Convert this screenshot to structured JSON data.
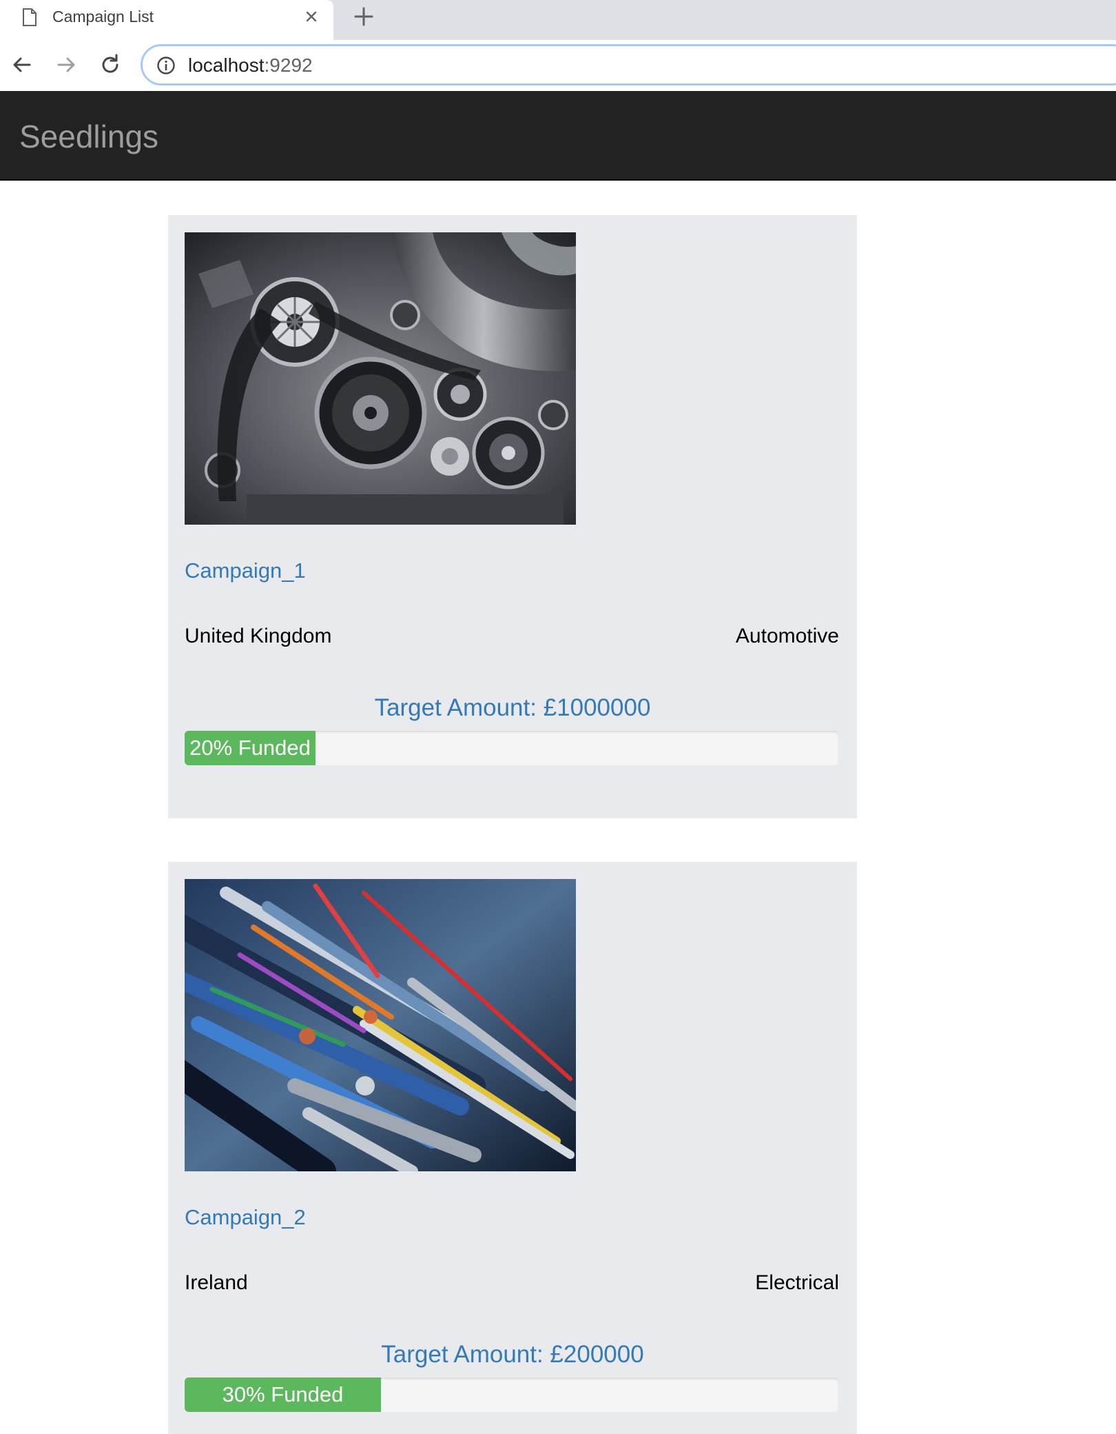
{
  "browser": {
    "tab_title": "Campaign List",
    "url_host": "localhost",
    "url_port": ":9292"
  },
  "navbar": {
    "brand": "Seedlings"
  },
  "campaigns": [
    {
      "name": "Campaign_1",
      "country": "United Kingdom",
      "category": "Automotive",
      "target": "Target Amount: £1000000",
      "funded_label": "20% Funded",
      "funded_percent": 20,
      "image": "engine-image"
    },
    {
      "name": "Campaign_2",
      "country": "Ireland",
      "category": "Electrical",
      "target": "Target Amount: £200000",
      "funded_label": "30% Funded",
      "funded_percent": 30,
      "image": "cables-image"
    }
  ],
  "colors": {
    "navbar_bg": "#222222",
    "brand_text": "#9d9d9d",
    "card_bg": "#e9eaee",
    "link_blue": "#337ab7",
    "progress_green": "#5cb85c"
  }
}
